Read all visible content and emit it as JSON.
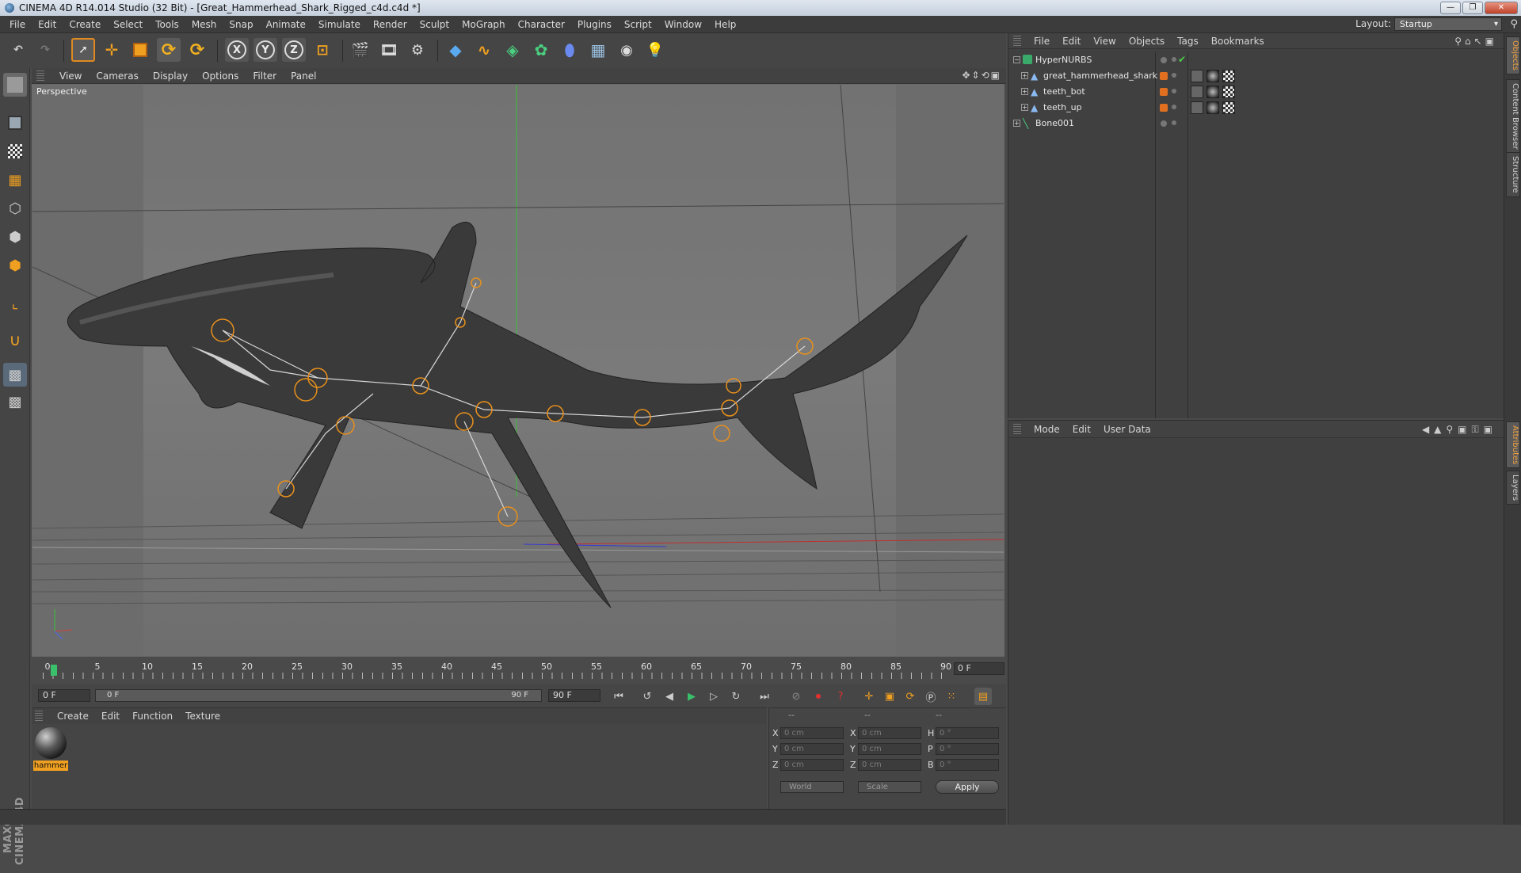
{
  "window": {
    "title": "CINEMA 4D R14.014 Studio (32 Bit) - [Great_Hammerhead_Shark_Rigged_c4d.c4d *]",
    "minimize": "—",
    "restore": "❐",
    "close": "✕"
  },
  "menubar": {
    "items": [
      "File",
      "Edit",
      "Create",
      "Select",
      "Tools",
      "Mesh",
      "Snap",
      "Animate",
      "Simulate",
      "Render",
      "Sculpt",
      "MoGraph",
      "Character",
      "Plugins",
      "Script",
      "Window",
      "Help"
    ],
    "layout_label": "Layout:",
    "layout_value": "Startup"
  },
  "toolbar": {
    "icons": [
      "undo-icon",
      "redo-icon",
      "live-select-icon",
      "move-icon",
      "scale-icon",
      "rotate-icon",
      "recent-tool-icon",
      "x-axis-icon",
      "y-axis-icon",
      "z-axis-icon",
      "world-coords-icon",
      "render-view-icon",
      "render-picture-viewer-icon",
      "edit-render-settings-icon",
      "cube-icon",
      "spline-icon",
      "nurbs-icon",
      "array-icon",
      "deformer-icon",
      "floor-icon",
      "camera-icon",
      "light-icon"
    ],
    "x_label": "X",
    "y_label": "Y",
    "z_label": "Z"
  },
  "viewport": {
    "menu": [
      "View",
      "Cameras",
      "Display",
      "Options",
      "Filter",
      "Panel"
    ],
    "label": "Perspective"
  },
  "timeline": {
    "ticks": [
      "0",
      "5",
      "10",
      "15",
      "20",
      "25",
      "30",
      "35",
      "40",
      "45",
      "50",
      "55",
      "60",
      "65",
      "70",
      "75",
      "80",
      "85",
      "90"
    ],
    "current_frame": "0 F",
    "start_field": "0 F",
    "slider_start": "0 F",
    "slider_end": "90 F",
    "end_field": "90 F"
  },
  "materials": {
    "menu": [
      "Create",
      "Edit",
      "Function",
      "Texture"
    ],
    "items": [
      {
        "name": "hammer"
      }
    ]
  },
  "coordinates": {
    "headers": [
      "--",
      "--",
      "--"
    ],
    "rows": [
      {
        "axis": "X",
        "pos": "0 cm",
        "size_axis": "X",
        "size": "0 cm",
        "rot_axis": "H",
        "rot": "0 °"
      },
      {
        "axis": "Y",
        "pos": "0 cm",
        "size_axis": "Y",
        "size": "0 cm",
        "rot_axis": "P",
        "rot": "0 °"
      },
      {
        "axis": "Z",
        "pos": "0 cm",
        "size_axis": "Z",
        "size": "0 cm",
        "rot_axis": "B",
        "rot": "0 °"
      }
    ],
    "mode_select": "World",
    "scale_select": "Scale",
    "apply": "Apply"
  },
  "objects": {
    "menu": [
      "File",
      "Edit",
      "View",
      "Objects",
      "Tags",
      "Bookmarks"
    ],
    "tree": [
      {
        "name": "HyperNURBS",
        "icon": "hypernurbs-icon"
      },
      {
        "name": "great_hammerhead_shark",
        "icon": "polygon-object-icon"
      },
      {
        "name": "teeth_bot",
        "icon": "polygon-object-icon"
      },
      {
        "name": "teeth_up",
        "icon": "polygon-object-icon"
      },
      {
        "name": "Bone001",
        "icon": "bone-icon"
      }
    ]
  },
  "attributes": {
    "menu": [
      "Mode",
      "Edit",
      "User Data"
    ]
  },
  "side_tabs": [
    "Objects",
    "Content Browser",
    "Structure",
    "Attributes",
    "Layers"
  ],
  "brand": "MAXON CINEMA 4D",
  "colors": {
    "accent": "#f0a020",
    "play": "#39c06a",
    "tag_orange": "#e07020"
  }
}
